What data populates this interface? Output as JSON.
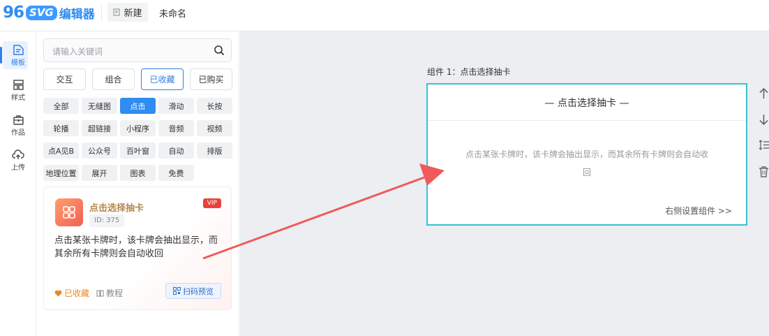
{
  "header": {
    "logo_number": "96",
    "logo_svg": "SVG",
    "logo_text": "编辑器",
    "new_label": "新建",
    "doc_title": "未命名"
  },
  "nav": {
    "items": [
      {
        "label": "模板",
        "icon": "template-icon"
      },
      {
        "label": "样式",
        "icon": "style-icon"
      },
      {
        "label": "作品",
        "icon": "briefcase-icon"
      },
      {
        "label": "上传",
        "icon": "cloud-upload-icon"
      }
    ]
  },
  "search": {
    "placeholder": "请输入关键词"
  },
  "tabs": [
    "交互",
    "组合",
    "已收藏",
    "已购买"
  ],
  "tags": [
    [
      "全部",
      "无缝图",
      "点击",
      "滑动",
      "长按"
    ],
    [
      "轮播",
      "超链接",
      "小程序",
      "音频",
      "视频"
    ],
    [
      "点A见B",
      "公众号",
      "百叶窗",
      "自动",
      "排版"
    ],
    [
      "地理位置",
      "展开",
      "图表",
      "免费"
    ]
  ],
  "card": {
    "title": "点击选择抽卡",
    "id": "ID: 375",
    "vip": "VIP",
    "desc": "点击某张卡牌时，该卡牌会抽出显示，而其余所有卡牌则会自动收回",
    "fav": "已收藏",
    "tutorial": "教程",
    "qr": "扫码预览"
  },
  "canvas": {
    "component_label": "组件 1：点击选择抽卡",
    "component_title": "— 点击选择抽卡 —",
    "component_desc_line1": "点击某张卡牌时，该卡牌会抽出显示，而其余所有卡牌则会自动收",
    "component_desc_line2": "回",
    "component_footer": "右侧设置组件 >>"
  },
  "colors": {
    "accent": "#2f7fe8",
    "component_border": "#35c4cf",
    "arrow": "#f05a5a",
    "vip": "#e8423b"
  }
}
